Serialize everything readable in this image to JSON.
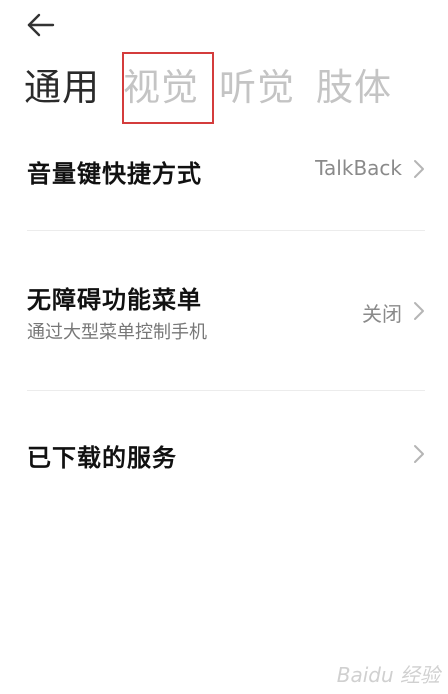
{
  "header": {
    "back_icon": "arrow-left-icon"
  },
  "tabs": [
    {
      "label": "通用",
      "active": true
    },
    {
      "label": "视觉",
      "active": false
    },
    {
      "label": "听觉",
      "active": false
    },
    {
      "label": "肢体",
      "active": false
    }
  ],
  "settings": [
    {
      "title": "音量键快捷方式",
      "subtitle": "",
      "value": "TalkBack",
      "icon": "chevron-right-icon"
    },
    {
      "title": "无障碍功能菜单",
      "subtitle": "通过大型菜单控制手机",
      "value": "关闭",
      "icon": "chevron-right-icon"
    },
    {
      "title": "已下载的服务",
      "subtitle": "",
      "value": "",
      "icon": "chevron-right-icon"
    }
  ],
  "watermark": {
    "text": "Baidu 经验"
  },
  "colors": {
    "highlight": "#d43c3c",
    "active_tab": "#2a2a2a",
    "inactive_tab": "#c4c4c4"
  }
}
